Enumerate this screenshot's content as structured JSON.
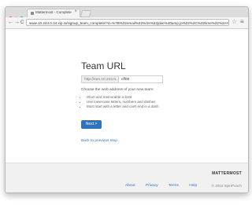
{
  "browser": {
    "tab_title": "Mattermost - Complete Te",
    "tab_close": "×",
    "url": "www.10.244.0.34.xip.io/signup_team_complete/?d=%7B%22email%22%3A%22jdoe%40amp.jo%22%2C%22time%22%3A%22144209175...",
    "back": "←",
    "forward": "→",
    "reload": "C",
    "star": "☆",
    "menu": "≡"
  },
  "colors": {
    "close": "#fc615d",
    "minimize": "#fdbc40",
    "maximize": "#34c84a",
    "accent": "#2d73c4"
  },
  "page": {
    "heading": "Team URL",
    "url_prefix": "http://mm.10.244.0...",
    "url_value": "cff00",
    "instruction": "Choose the web address of your new team:",
    "rules": [
      "Short and memorable is best",
      "Use lowercase letters, numbers and dashes",
      "Must start with a letter and can't end in a dash"
    ],
    "next_label": "Next >",
    "back_label": "Back to previous step"
  },
  "footer": {
    "brand": "MATTERMOST",
    "links": [
      "About",
      "Privacy",
      "Terms",
      "Help"
    ],
    "copyright": "© 2015 SpinPunch"
  }
}
